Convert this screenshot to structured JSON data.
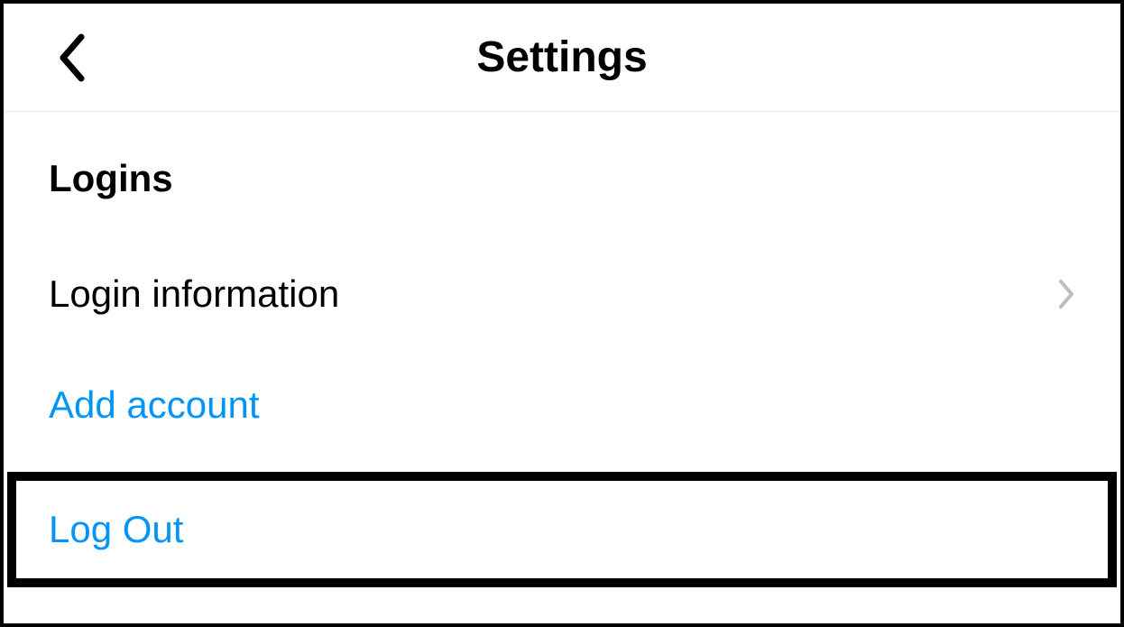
{
  "header": {
    "title": "Settings"
  },
  "section": {
    "title": "Logins"
  },
  "items": {
    "login_info": "Login information",
    "add_account": "Add account",
    "log_out": "Log Out"
  }
}
